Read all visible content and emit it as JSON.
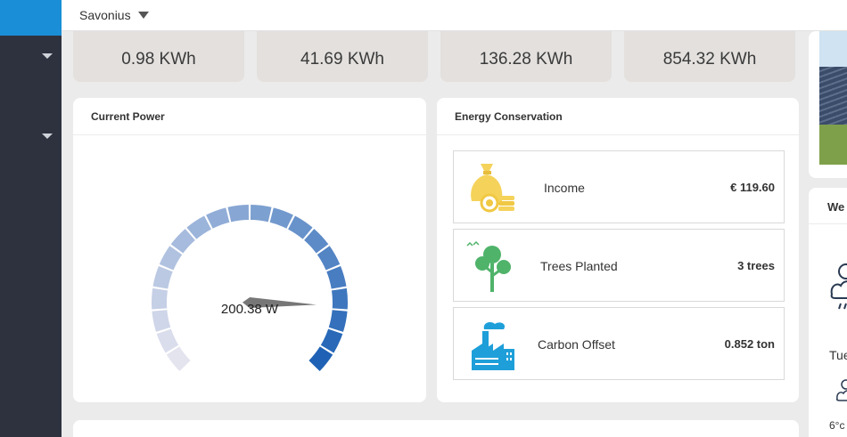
{
  "topbar": {
    "site_name": "Savonius"
  },
  "stats": [
    {
      "value": "0.98 KWh"
    },
    {
      "value": "41.69 KWh"
    },
    {
      "value": "136.28 KWh"
    },
    {
      "value": "854.32 KWh"
    }
  ],
  "current_power": {
    "title": "Current Power",
    "value_text": "200.38 W",
    "gauge_fraction": 0.84
  },
  "energy_conservation": {
    "title": "Energy Conservation",
    "rows": [
      {
        "label": "Income",
        "value": "€ 119.60",
        "icon": "money-bag-icon",
        "color": "#f5d25a"
      },
      {
        "label": "Trees Planted",
        "value": "3 trees",
        "icon": "tree-icon",
        "color": "#4fb36a"
      },
      {
        "label": "Carbon Offset",
        "value": "0.852 ton",
        "icon": "factory-icon",
        "color": "#1e9fd9"
      }
    ]
  },
  "weather": {
    "title": "We",
    "day": "Tue",
    "temp": "6°c"
  },
  "colors": {
    "sidebar": "#2e323f",
    "brand": "#1a8ed6",
    "gauge_light": "#e4e4ef",
    "gauge_dark": "#1f62b5"
  }
}
